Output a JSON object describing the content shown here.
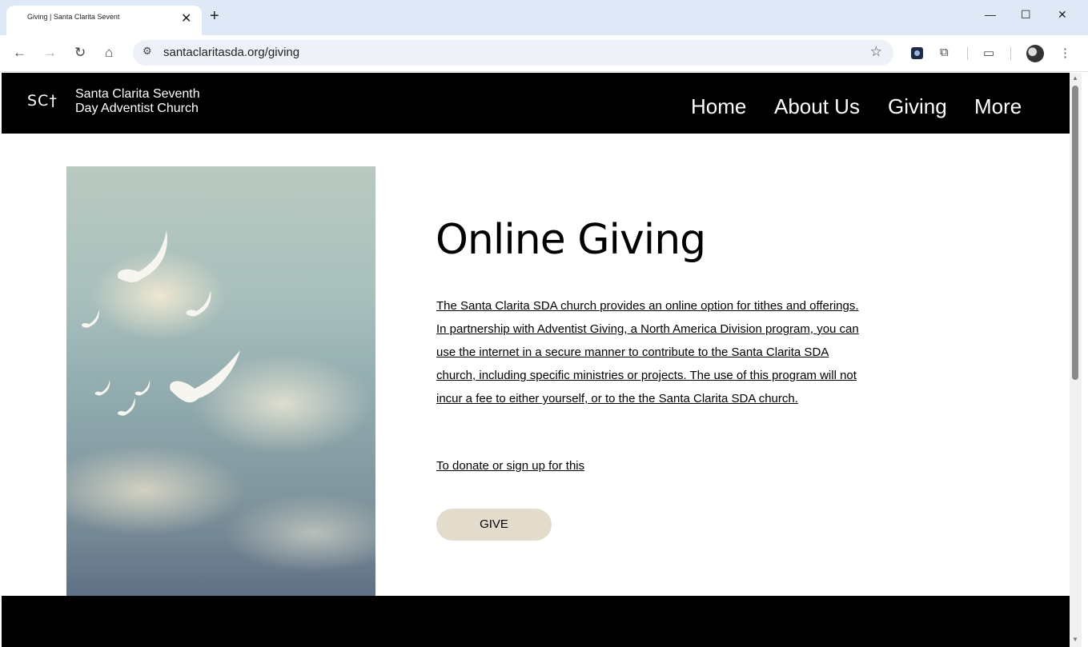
{
  "browser": {
    "tab_title": "Giving | Santa Clarita Sevent",
    "tab_close": "✕",
    "new_tab": "+",
    "url": "santaclaritasda.org/giving",
    "window_controls": {
      "minimize": "—",
      "maximize": "☐",
      "close": "✕"
    }
  },
  "header": {
    "logo_mark": "SC†",
    "logo_line1": "Santa Clarita Seventh",
    "logo_line2": "Day Adventist Church",
    "nav": [
      "Home",
      "About Us",
      "Giving",
      "More"
    ]
  },
  "main": {
    "title": "Online Giving",
    "body": "The Santa Clarita SDA church provides an online option for tithes and offerings. In partnership with Adventist Giving, a North America Division program, you can use the internet in a secure manner to contribute to the Santa Clarita SDA church, including specific ministries or projects. The use of this program will not incur a fee to either yourself, or to the the Santa Clarita SDA church.",
    "donate_link": "To donate or sign up for this",
    "give_button": "GIVE"
  },
  "icons": [
    "back-icon",
    "forward-icon",
    "reload-icon",
    "home-icon",
    "site-info-icon",
    "bookmark-star-icon",
    "extension-icon",
    "puzzle-icon",
    "tab-search-icon",
    "profile-avatar",
    "menu-icon"
  ]
}
